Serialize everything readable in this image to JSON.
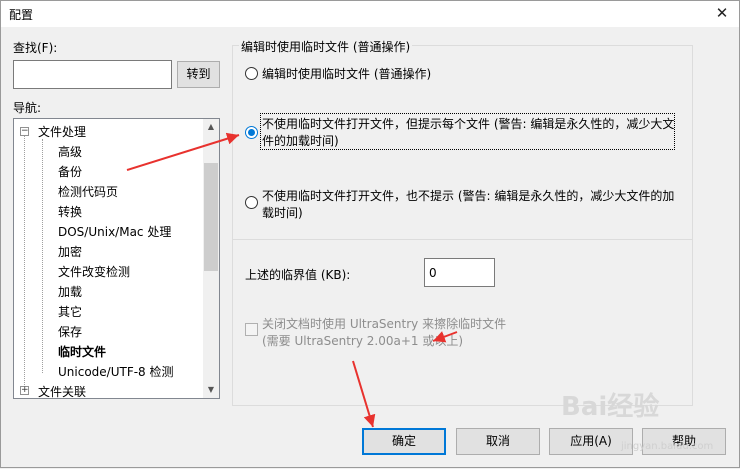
{
  "window": {
    "title": "配置",
    "close_glyph": "✕"
  },
  "left": {
    "find_label": "查找(F):",
    "find_value": "",
    "goto_label": "转到",
    "nav_label": "导航:"
  },
  "tree": {
    "root_expander": "−",
    "root": "文件处理",
    "items": [
      "高级",
      "备份",
      "检测代码页",
      "转换",
      "DOS/Unix/Mac 处理",
      "加密",
      "文件改变检测",
      "加载",
      "其它",
      "保存",
      "临时文件",
      "Unicode/UTF-8 检测"
    ],
    "selected_index": 10,
    "next_expander": "+",
    "next_root": "文件关联",
    "scroll_up": "▲",
    "scroll_down": "▼"
  },
  "group": {
    "title": "编辑时使用临时文件 (普通操作)",
    "options": [
      {
        "line1": "编辑时使用临时文件 (普通操作)",
        "line2": "",
        "checked": false
      },
      {
        "line1": "不使用临时文件打开文件，但提示每个文件 (警告: 编辑是永久性的，减少大文",
        "line2": "件的加载时间)",
        "checked": true
      },
      {
        "line1": "不使用临时文件打开文件，也不提示 (警告: 编辑是永久性的，减少大文件的加",
        "line2": "载时间)",
        "checked": false
      }
    ],
    "threshold_label": "上述的临界值 (KB):",
    "threshold_value": "0",
    "ultrasentry_line1": "关闭文档时使用 UltraSentry 来擦除临时文件",
    "ultrasentry_line2": "(需要 UltraSentry 2.00a+1 或以上)",
    "ultrasentry_checked": false
  },
  "buttons": {
    "ok": "确定",
    "cancel": "取消",
    "apply": "应用(A)",
    "help": "帮助"
  },
  "watermark": {
    "text": "Bai经验",
    "sub": "jingyan.baidu.com"
  },
  "colors": {
    "accent": "#0078d7",
    "annotation_arrow": "#e8322e"
  }
}
